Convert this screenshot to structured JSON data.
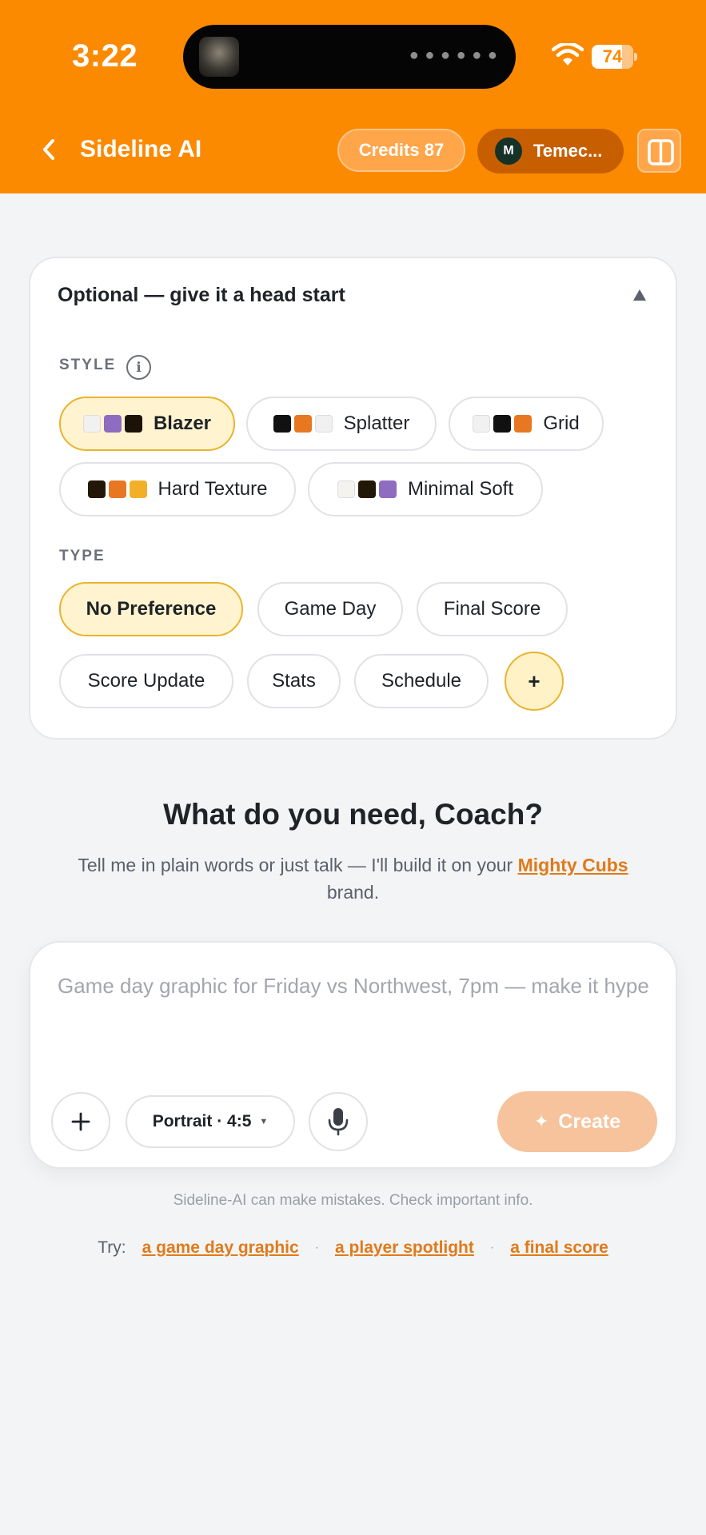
{
  "status_bar": {
    "time": "3:22",
    "battery": "74",
    "battery_level": 0.74
  },
  "header": {
    "title": "Sideline AI",
    "credits": "Credits 87",
    "team": {
      "avatar_initial": "M",
      "name": "Temec..."
    },
    "colors": {
      "brand": "#fb8a00",
      "team_pill": "#c75f00"
    }
  },
  "options": {
    "title": "Optional — give it a head start",
    "style_label": "STYLE",
    "styles": [
      {
        "label": "Blazer",
        "selected": true,
        "swatches": [
          "#f1f1f1",
          "#8e6cbf",
          "#1c1208"
        ]
      },
      {
        "label": "Splatter",
        "selected": false,
        "swatches": [
          "#111111",
          "#e87722",
          "#f0f0f0"
        ]
      },
      {
        "label": "Grid",
        "selected": false,
        "swatches": [
          "#f1f1f1",
          "#111111",
          "#e87722"
        ]
      },
      {
        "label": "Hard Texture",
        "selected": false,
        "swatches": [
          "#231808",
          "#e87722",
          "#f2b02a"
        ]
      },
      {
        "label": "Minimal Soft",
        "selected": false,
        "swatches": [
          "#f5f3ee",
          "#231808",
          "#8e6cbf"
        ]
      }
    ],
    "type_label": "TYPE",
    "types": [
      {
        "label": "No Preference",
        "selected": true
      },
      {
        "label": "Game Day",
        "selected": false
      },
      {
        "label": "Final Score",
        "selected": false
      },
      {
        "label": "Score Update",
        "selected": false
      },
      {
        "label": "Stats",
        "selected": false
      },
      {
        "label": "Schedule",
        "selected": false
      }
    ],
    "more_label": "+"
  },
  "main": {
    "heading": "What do you need, Coach?",
    "subtitle_prefix": "Tell me in plain words or just talk — I'll build it on your ",
    "subtitle_brand": "Mighty Cubs",
    "subtitle_suffix": " brand."
  },
  "composer": {
    "placeholder": "Game day graphic for Friday vs Northwest, 7pm — make it hype",
    "value": "",
    "attach_label": "+",
    "format": "Portrait · 4:5",
    "create_label": "Create"
  },
  "footer": {
    "disclaimer": "Sideline-AI can make mistakes. Check important info.",
    "try_label": "Try:",
    "suggestions": [
      "a game day graphic",
      "a player spotlight",
      "a final score"
    ]
  }
}
